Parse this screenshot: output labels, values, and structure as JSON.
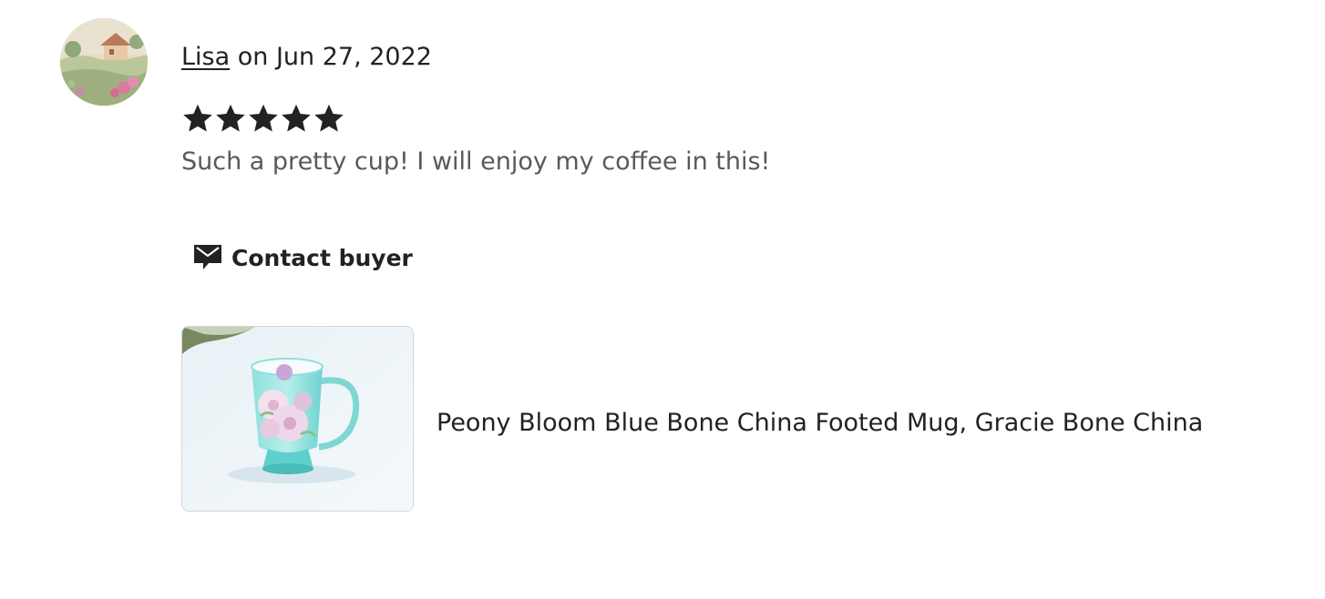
{
  "review": {
    "reviewer_name": "Lisa",
    "date_text": " on Jun 27, 2022",
    "rating": 5,
    "rating_max": 5,
    "text": "Such a pretty cup! I will enjoy my coffee in this!"
  },
  "actions": {
    "contact_label": "Contact buyer"
  },
  "product": {
    "title": "Peony Bloom Blue Bone China Footed Mug, Gracie Bone China"
  },
  "colors": {
    "text_primary": "#222222",
    "text_secondary": "#595959",
    "star": "#222222"
  },
  "icons": {
    "contact": "envelope-icon",
    "rating": "star-icon"
  }
}
